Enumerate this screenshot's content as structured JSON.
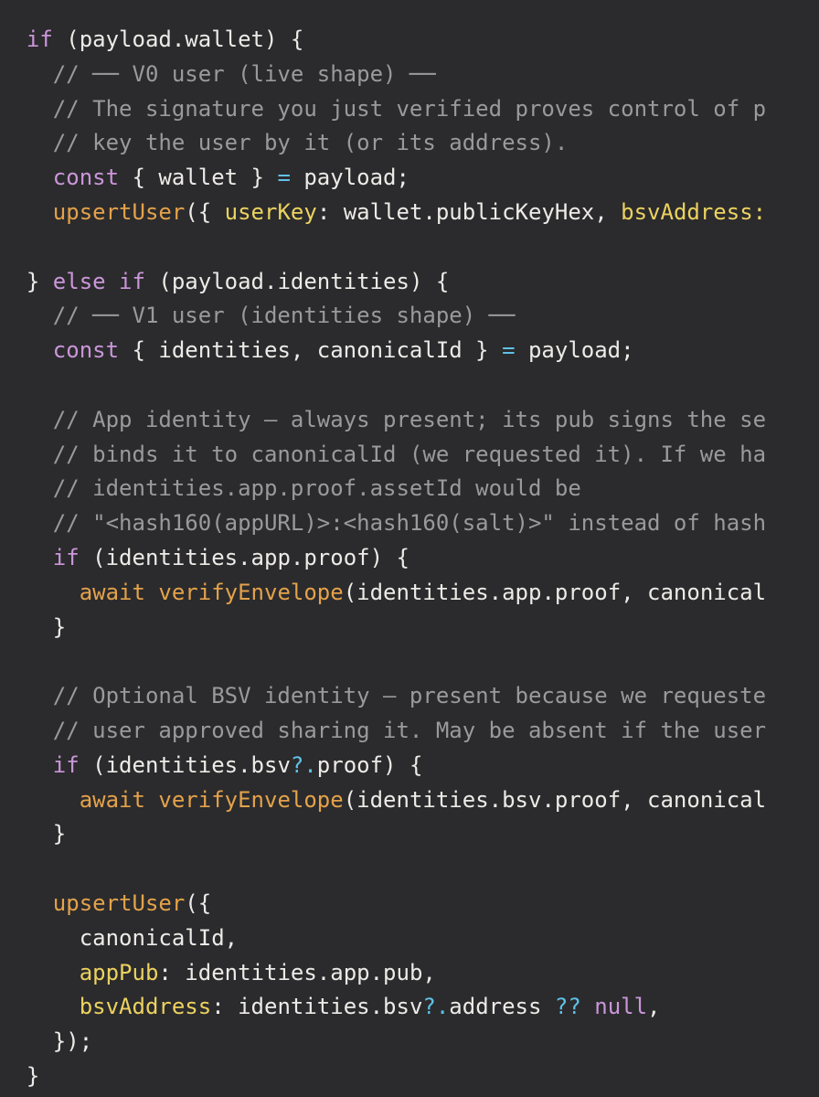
{
  "editor": {
    "background": "#2b2b2d",
    "theme_colors": {
      "keyword": "#cb96da",
      "comment": "#9a9a9a",
      "function": "#e4a24a",
      "property": "#ecd25f",
      "operator": "#5fc2e8",
      "text": "#ecebe7"
    },
    "lines": [
      [
        {
          "t": "  "
        },
        {
          "t": "if",
          "c": "k"
        },
        {
          "t": " (payload.wallet) {"
        }
      ],
      [
        {
          "t": "    // ── V0 user (live shape) ──",
          "c": "c"
        }
      ],
      [
        {
          "t": "    // The signature you just verified proves control of p",
          "c": "c"
        }
      ],
      [
        {
          "t": "    // key the user by it (or its address).",
          "c": "c"
        }
      ],
      [
        {
          "t": "    "
        },
        {
          "t": "const",
          "c": "k"
        },
        {
          "t": " { wallet } "
        },
        {
          "t": "=",
          "c": "o"
        },
        {
          "t": " payload;"
        }
      ],
      [
        {
          "t": "    "
        },
        {
          "t": "upsertUser",
          "c": "f"
        },
        {
          "t": "({ "
        },
        {
          "t": "userKey",
          "c": "p"
        },
        {
          "t": ": wallet.publicKeyHex, "
        },
        {
          "t": "bsvAddress:",
          "c": "p"
        }
      ],
      [],
      [
        {
          "t": "  } "
        },
        {
          "t": "else if",
          "c": "k"
        },
        {
          "t": " (payload.identities) {"
        }
      ],
      [
        {
          "t": "    // ── V1 user (identities shape) ──",
          "c": "c"
        }
      ],
      [
        {
          "t": "    "
        },
        {
          "t": "const",
          "c": "k"
        },
        {
          "t": " { identities, canonicalId } "
        },
        {
          "t": "=",
          "c": "o"
        },
        {
          "t": " payload;"
        }
      ],
      [],
      [
        {
          "t": "    // App identity — always present; its pub signs the se",
          "c": "c"
        }
      ],
      [
        {
          "t": "    // binds it to canonicalId (we requested it). If we ha",
          "c": "c"
        }
      ],
      [
        {
          "t": "    // identities.app.proof.assetId would be",
          "c": "c"
        }
      ],
      [
        {
          "t": "    // \"<hash160(appURL)>:<hash160(salt)>\" instead of hash",
          "c": "c"
        }
      ],
      [
        {
          "t": "    "
        },
        {
          "t": "if",
          "c": "k"
        },
        {
          "t": " (identities.app.proof) {"
        }
      ],
      [
        {
          "t": "      "
        },
        {
          "t": "await",
          "c": "f"
        },
        {
          "t": " "
        },
        {
          "t": "verifyEnvelope",
          "c": "f"
        },
        {
          "t": "(identities.app.proof, canonical"
        }
      ],
      [
        {
          "t": "    }"
        }
      ],
      [],
      [
        {
          "t": "    // Optional BSV identity — present because we requeste",
          "c": "c"
        }
      ],
      [
        {
          "t": "    // user approved sharing it. May be absent if the user",
          "c": "c"
        }
      ],
      [
        {
          "t": "    "
        },
        {
          "t": "if",
          "c": "k"
        },
        {
          "t": " (identities.bsv"
        },
        {
          "t": "?.",
          "c": "o"
        },
        {
          "t": "proof) {"
        }
      ],
      [
        {
          "t": "      "
        },
        {
          "t": "await",
          "c": "f"
        },
        {
          "t": " "
        },
        {
          "t": "verifyEnvelope",
          "c": "f"
        },
        {
          "t": "(identities.bsv.proof, canonical"
        }
      ],
      [
        {
          "t": "    }"
        }
      ],
      [],
      [
        {
          "t": "    "
        },
        {
          "t": "upsertUser",
          "c": "f"
        },
        {
          "t": "({"
        }
      ],
      [
        {
          "t": "      canonicalId,"
        }
      ],
      [
        {
          "t": "      "
        },
        {
          "t": "appPub",
          "c": "p"
        },
        {
          "t": ": identities.app.pub,"
        }
      ],
      [
        {
          "t": "      "
        },
        {
          "t": "bsvAddress",
          "c": "p"
        },
        {
          "t": ": identities.bsv"
        },
        {
          "t": "?.",
          "c": "o"
        },
        {
          "t": "address "
        },
        {
          "t": "??",
          "c": "o"
        },
        {
          "t": " "
        },
        {
          "t": "null",
          "c": "k"
        },
        {
          "t": ","
        }
      ],
      [
        {
          "t": "    });"
        }
      ],
      [
        {
          "t": "  }"
        }
      ]
    ]
  }
}
